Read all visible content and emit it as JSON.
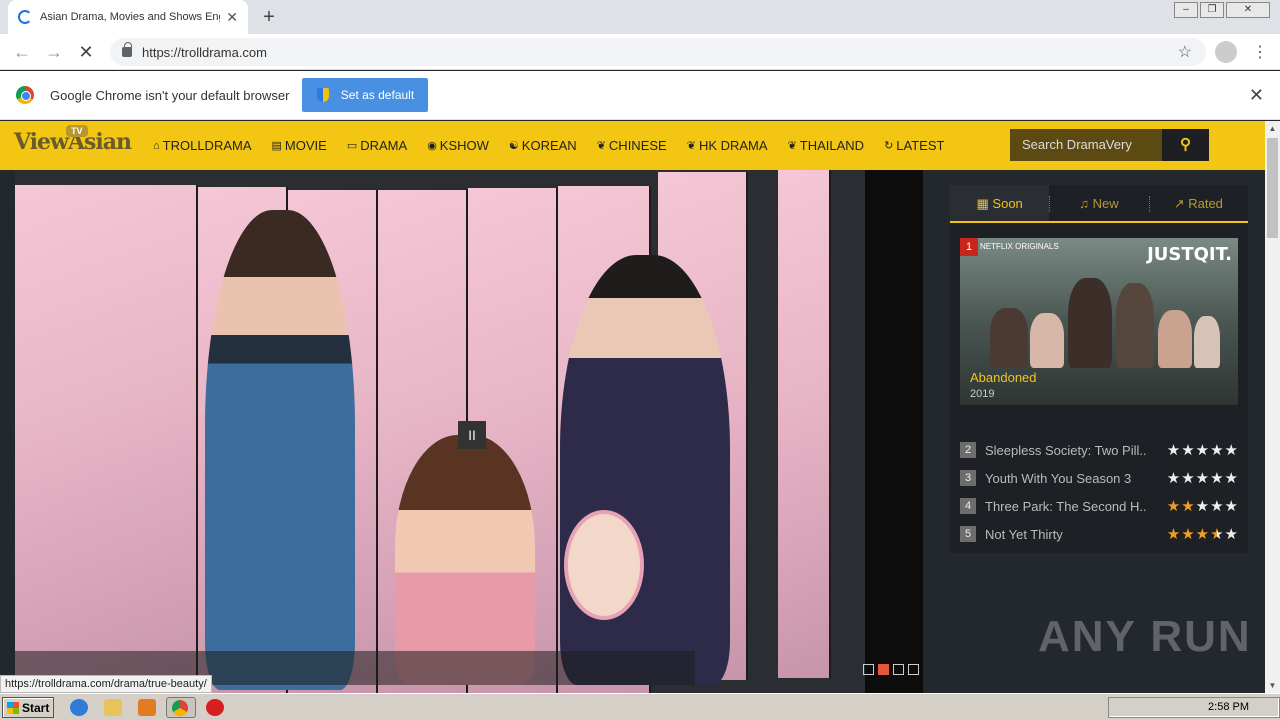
{
  "browser": {
    "tab_title": "Asian Drama, Movies and Shows English",
    "url": "https://trolldrama.com",
    "infobar_text": "Google Chrome isn't your default browser",
    "set_default_label": "Set as default"
  },
  "site": {
    "logo_text": "ViewAsian",
    "logo_badge": "TV",
    "nav": [
      {
        "label": "TROLLDRAMA",
        "icon": "home-icon"
      },
      {
        "label": "MOVIE",
        "icon": "film-icon"
      },
      {
        "label": "DRAMA",
        "icon": "monitor-icon"
      },
      {
        "label": "KSHOW",
        "icon": "globe-icon"
      },
      {
        "label": "KOREAN",
        "icon": "korean-icon"
      },
      {
        "label": "CHINESE",
        "icon": "leaf-icon"
      },
      {
        "label": "HK DRAMA",
        "icon": "leaf-icon"
      },
      {
        "label": "THAILAND",
        "icon": "leaf-icon"
      },
      {
        "label": "LATEST",
        "icon": "refresh-icon"
      }
    ],
    "search_placeholder": "Search DramaVery"
  },
  "sidebar": {
    "tabs": [
      {
        "label": "Soon",
        "icon": "calendar-icon"
      },
      {
        "label": "New",
        "icon": "bell-icon"
      },
      {
        "label": "Rated",
        "icon": "chart-icon"
      }
    ],
    "featured": {
      "rank": "1",
      "title": "Abandoned",
      "year": "2019",
      "brand": "JUSTQIT.",
      "badge": "NETFLIX ORIGINALS"
    },
    "list": [
      {
        "rank": "2",
        "title": "Sleepless Society: Two Pill...",
        "rating": 0
      },
      {
        "rank": "3",
        "title": "Youth With You Season 3",
        "rating": 0
      },
      {
        "rank": "4",
        "title": "Three Park: The Second H...",
        "rating": 2
      },
      {
        "rank": "5",
        "title": "Not Yet Thirty",
        "rating": 3.5
      }
    ]
  },
  "slider": {
    "pause_glyph": "II",
    "slides_count": 4,
    "active_slide": 2
  },
  "status_url": "https://trolldrama.com/drama/true-beauty/",
  "watermark": "ANY RUN",
  "taskbar": {
    "start_label": "Start",
    "clock": "2:58 PM"
  },
  "colors": {
    "brand_yellow": "#f3c614",
    "sidebar_bg": "#1d2024",
    "accent_orange": "#e8563a"
  }
}
